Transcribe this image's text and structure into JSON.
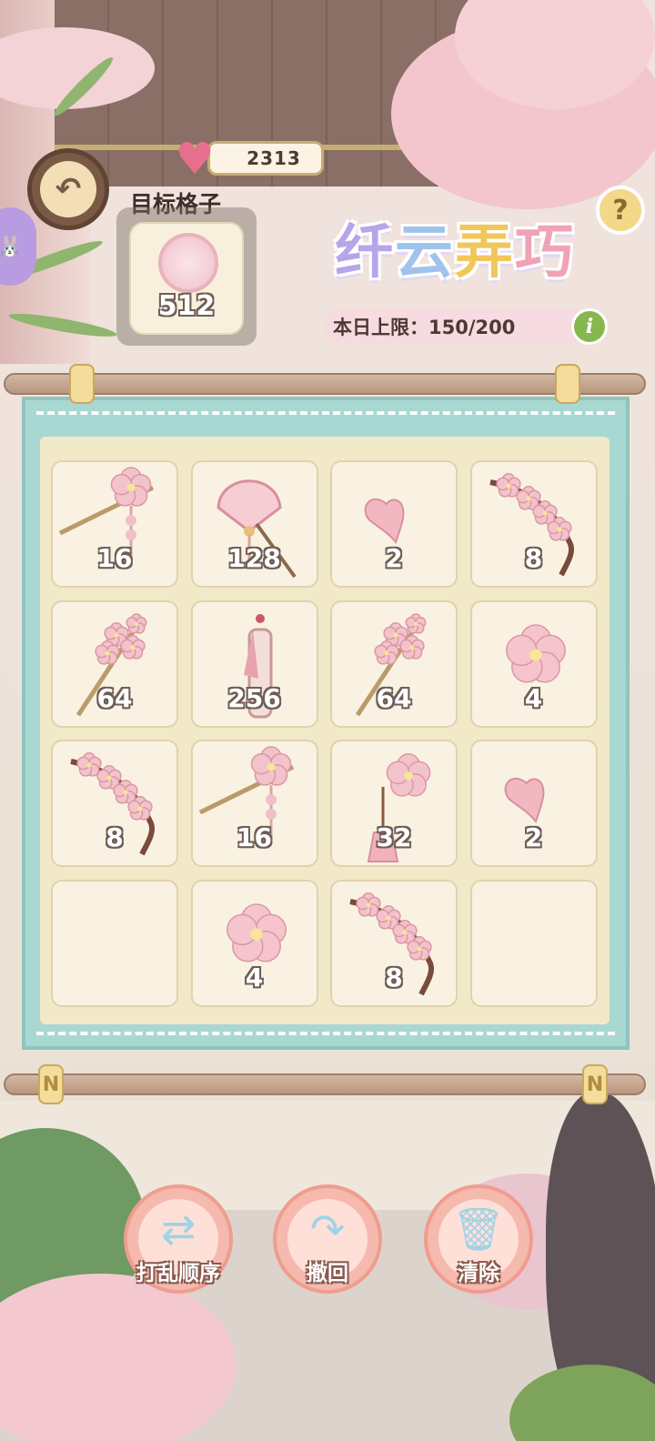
{
  "header": {
    "currency_value": "2313",
    "target_label": "目标格子",
    "target_value": "512",
    "title_chars": [
      "纤",
      "云",
      "弄",
      "巧"
    ],
    "daily_limit": "本日上限：150/200",
    "help_symbol": "?",
    "info_symbol": "i"
  },
  "grid": {
    "cells": [
      {
        "item": "hairpin-flower",
        "value": "16"
      },
      {
        "item": "fan-hairpin",
        "value": "128"
      },
      {
        "item": "petal",
        "value": "2"
      },
      {
        "item": "blossom-branch",
        "value": "8"
      },
      {
        "item": "blossom-hairpin",
        "value": "64"
      },
      {
        "item": "jade-pendant",
        "value": "256"
      },
      {
        "item": "blossom-hairpin",
        "value": "64"
      },
      {
        "item": "blossom",
        "value": "4"
      },
      {
        "item": "blossom-branch",
        "value": "8"
      },
      {
        "item": "hairpin-flower",
        "value": "16"
      },
      {
        "item": "tassel-flower",
        "value": "32"
      },
      {
        "item": "petal",
        "value": "2"
      },
      {
        "item": "empty",
        "value": ""
      },
      {
        "item": "blossom",
        "value": "4"
      },
      {
        "item": "blossom-branch",
        "value": "8"
      },
      {
        "item": "empty",
        "value": ""
      }
    ]
  },
  "actions": {
    "shuffle_label": "打乱顺序",
    "undo_label": "撤回",
    "clear_label": "清除"
  },
  "rod_caps": [
    "N",
    "N"
  ],
  "colors": {
    "board": "#a9d8d2",
    "cell": "#f9f2e2",
    "accent_pink": "#f0a2b6",
    "number_outline": "#6e5d56"
  }
}
